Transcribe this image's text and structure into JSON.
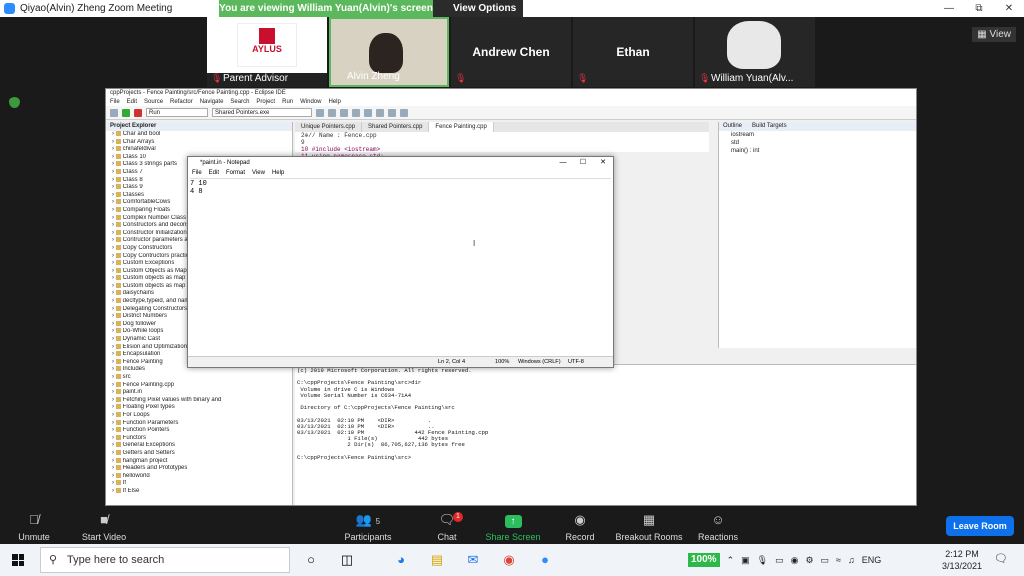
{
  "zoom": {
    "window_title": "Qiyao(Alvin) Zheng   Zoom Meeting",
    "viewing_banner": "You are viewing William Yuan(Alvin)'s screen",
    "view_options": "View Options",
    "view_label": "View",
    "participants": [
      {
        "name": "Parent Advisor",
        "muted": true
      },
      {
        "name": "Alvin Zheng",
        "muted": false
      },
      {
        "name": "Andrew Chen",
        "muted": true
      },
      {
        "name": "Ethan",
        "muted": true
      },
      {
        "name": "William Yuan(Alv...",
        "muted": true
      }
    ],
    "aylus_text": "AYLUS",
    "toolbar": {
      "unmute": "Unmute",
      "start_video": "Start Video",
      "participants": "Participants",
      "participants_count": "5",
      "chat": "Chat",
      "chat_badge": "1",
      "share_screen": "Share Screen",
      "record": "Record",
      "breakout_rooms": "Breakout Rooms",
      "reactions": "Reactions",
      "leave_room": "Leave Room"
    },
    "colors": {
      "share_green": "#2dbd5e",
      "leave_blue": "#0e71eb",
      "banner_green": "#5cb85c"
    }
  },
  "eclipse": {
    "title": "cppProjects - Fence Painting/src/Fence Painting.cpp - Eclipse IDE",
    "menu": [
      "File",
      "Edit",
      "Source",
      "Refactor",
      "Navigate",
      "Search",
      "Project",
      "Run",
      "Window",
      "Help"
    ],
    "run_select": "Run",
    "launch_select": "Shared Pointers.exe",
    "project_explorer_title": "Project Explorer",
    "project_items": [
      "Char and bool",
      "Char Arrays",
      "chinafeldival",
      "Class 10",
      "Class 3 strings parts",
      "Class 7",
      "Class 8",
      "Class 9",
      "Classes",
      "ComfortableCows",
      "Comparing Floats",
      "Complex Number Class",
      "Constructors and deconstruct",
      "Constructor Initialization List",
      "Contructor parameters and o",
      "Copy Constructors",
      "Copy Contructors practice",
      "Custom Exceptions",
      "Custom Objects as Map keys",
      "Custom objects as map value",
      "Custom objects as map valu",
      "daisychains",
      "decltype,typeid, and name m",
      "Delegating Constructors",
      "District Numbers",
      "Dog follower",
      "Do-While loops",
      "Dynamic Cast",
      "Elision and Optimization",
      "Encapsulation",
      "Fence Painting",
      "Includes",
      "src",
      "Fence Painting.cpp",
      "paint.in",
      "Fetching Pixel values with binary and",
      "Floating Pixel types",
      "For Loops",
      "Function Parameters",
      "Function Pointers",
      "Functors",
      "General Exceptions",
      "Getters and Setters",
      "hangman project",
      "Headers and Prototypes",
      "helloworld",
      "If",
      "If Else"
    ],
    "editor_tabs": [
      "Unique Pointers.cpp",
      "Shared Pointers.cpp",
      "Fence Painting.cpp"
    ],
    "code_lines": [
      "  2⊕// Name        : Fence.cpp",
      "  9",
      " 10  #include <iostream>",
      " 11  using namespace std;"
    ],
    "outline_title": "Outline",
    "build_targets": "Build Targets",
    "outline_items": [
      "iostream",
      "std",
      "main() : int"
    ],
    "console_lines": [
      "(c) 2019 Microsoft Corporation. All rights reserved.",
      "",
      "C:\\cppProjects\\Fence Painting\\src>dir",
      " Volume in drive C is Windows",
      " Volume Serial Number is C634-71A4",
      "",
      " Directory of C:\\cppProjects\\Fence Painting\\src",
      "",
      "03/13/2021  02:10 PM    <DIR>          .",
      "03/13/2021  02:10 PM    <DIR>          ..",
      "03/13/2021  02:10 PM               442 Fence Painting.cpp",
      "               1 File(s)            442 bytes",
      "               2 Dir(s)  86,705,627,136 bytes free",
      "",
      "C:\\cppProjects\\Fence Painting\\src>"
    ]
  },
  "notepad": {
    "title": "*paint.in - Notepad",
    "menu": [
      "File",
      "Edit",
      "Format",
      "View",
      "Help"
    ],
    "lines": [
      "7 10",
      "4 8"
    ],
    "status": {
      "position": "Ln 2, Col 4",
      "zoom": "100%",
      "line_ending": "Windows (CRLF)",
      "encoding": "UTF-8"
    }
  },
  "taskbar": {
    "search_placeholder": "Type here to search",
    "battery_percent": "100%",
    "language": "ENG",
    "time": "2:12 PM",
    "date": "3/13/2021"
  }
}
